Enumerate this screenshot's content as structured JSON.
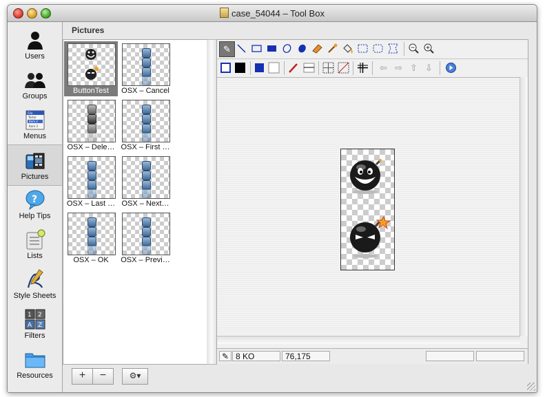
{
  "window": {
    "title": "case_54044 – Tool Box"
  },
  "sidebar": {
    "items": [
      {
        "label": "Users",
        "icon": "users-icon"
      },
      {
        "label": "Groups",
        "icon": "groups-icon"
      },
      {
        "label": "Menus",
        "icon": "menus-icon",
        "menu_preview": [
          "File",
          "Testar",
          "Item 2",
          "Item 3"
        ]
      },
      {
        "label": "Pictures",
        "icon": "pictures-icon",
        "active": true
      },
      {
        "label": "Help Tips",
        "icon": "help-tips-icon"
      },
      {
        "label": "Lists",
        "icon": "lists-icon"
      },
      {
        "label": "Style Sheets",
        "icon": "style-sheets-icon"
      },
      {
        "label": "Filters",
        "icon": "filters-icon",
        "keys": [
          "1",
          "2",
          "A",
          "Z"
        ]
      },
      {
        "label": "Resources",
        "icon": "resources-icon"
      }
    ]
  },
  "pictures": {
    "heading": "Pictures",
    "items": [
      {
        "label": "ButtonTest",
        "selected": true
      },
      {
        "label": "OSX – Cancel"
      },
      {
        "label": "OSX – Dele…"
      },
      {
        "label": "OSX – First …"
      },
      {
        "label": "OSX – Last …"
      },
      {
        "label": "OSX – Next…"
      },
      {
        "label": "OSX – OK"
      },
      {
        "label": "OSX – Previ…"
      }
    ],
    "buttons": {
      "add": "+",
      "remove": "−",
      "actions": "⚙▾"
    }
  },
  "editor": {
    "status": {
      "size": "8 KO",
      "coords": "76,175"
    }
  },
  "colors": {
    "selection": "#7b7b7b",
    "tool_accent": "#1530b0"
  }
}
